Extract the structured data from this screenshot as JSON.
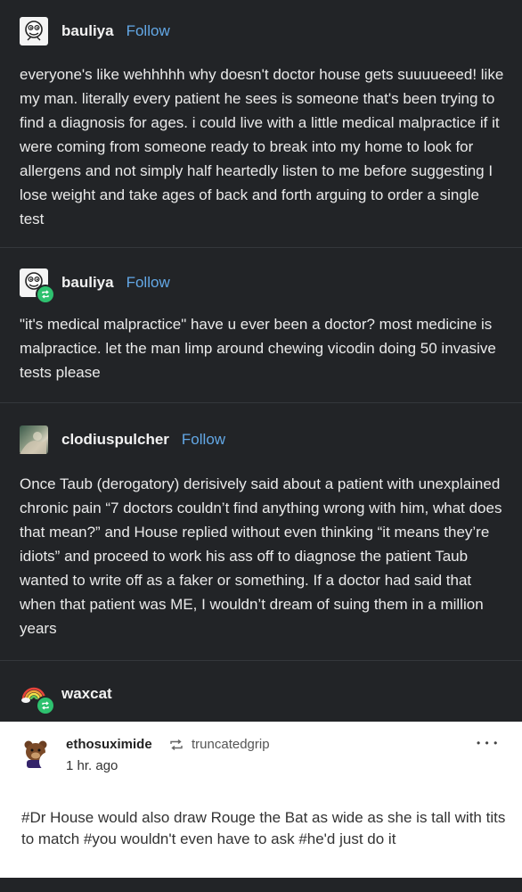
{
  "posts": [
    {
      "username": "bauliya",
      "follow": "Follow",
      "text": "everyone's like wehhhhh why doesn't doctor house gets suuuueeed! like my man. literally every patient he sees is someone that's been trying to find a diagnosis for ages. i could live with a little medical malpractice if it were coming from someone ready to break into my home to look for allergens and not simply half heartedly listen to me before suggesting I lose weight and take ages of back and forth arguing to order a single test"
    },
    {
      "username": "bauliya",
      "follow": "Follow",
      "text": "\"it's medical malpractice\" have u ever been a doctor? most medicine is malpractice. let the man limp around chewing vicodin doing 50 invasive tests please"
    },
    {
      "username": "clodiuspulcher",
      "follow": "Follow",
      "text": "Once Taub (derogatory) derisively said about a patient with unexplained chronic pain “7 doctors couldn’t find anything wrong with him, what does that mean?” and House replied without even thinking “it means they’re idiots” and proceed to work his ass off to diagnose the patient Taub wanted to write off as a faker or something. If a doctor had said that when that patient was ME, I wouldn’t dream of suing them in a million years"
    },
    {
      "username": "waxcat"
    }
  ],
  "reblog_card": {
    "username": "ethosuximide",
    "via": "truncatedgrip",
    "time": "1 hr. ago",
    "more": "• • •",
    "tags": "#Dr House would also draw Rouge the Bat as wide as she is tall with tits to match  #you wouldn't even have to ask  #he'd just do it"
  },
  "colors": {
    "dark_bg": "#222427",
    "follow_blue": "#63a8e6",
    "reblog_green": "#2ec16f"
  }
}
